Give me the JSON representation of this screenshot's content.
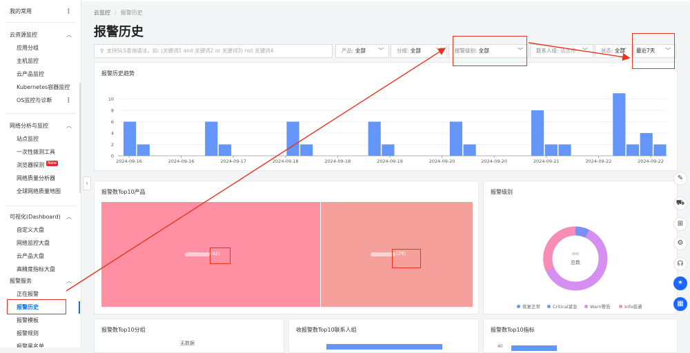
{
  "sidebar": {
    "favorites": "我的常用",
    "groups": [
      {
        "label": "云资源监控",
        "items": [
          "应用分组",
          "主机监控",
          "云产品监控",
          "Kubernetes容器监控",
          "OS监控与诊断"
        ]
      },
      {
        "label": "网络分析与监控",
        "items": [
          "站点监控",
          "一次性拨测工具",
          "浏览器探测",
          "网络质量分析器",
          "全球网络质量地图"
        ]
      },
      {
        "label": "可视化(Dashboard)",
        "items": [
          "自定义大盘",
          "网络监控大盘",
          "云产品大盘",
          "高精度指标大盘"
        ]
      },
      {
        "label": "报警服务",
        "items": [
          "正在报警",
          "报警历史",
          "报警模板",
          "报警规则",
          "报警黑名单"
        ]
      }
    ],
    "new_badge": "New"
  },
  "breadcrumb": {
    "root": "云监控",
    "current": "报警历史"
  },
  "page_title": "报警历史",
  "filters": {
    "search_placeholder": "支持SLS查询语法，如: (关键词1 and 关键词2 or 关键词3) not 关键词4",
    "product_label": "产品:",
    "product_value": "全部",
    "group_label": "分组:",
    "group_value": "全部",
    "level_label": "报警级别:",
    "level_value": "全部",
    "contact_label": "联系人组:",
    "contact_value": "请选择",
    "status_label": "状态:",
    "status_value": "全部",
    "time_value": "最近7天"
  },
  "trend_card": {
    "title": "报警历史趋势"
  },
  "chart_data": {
    "type": "bar",
    "ylim": [
      0,
      12
    ],
    "yticks": [
      0,
      2,
      4,
      6,
      8,
      10
    ],
    "xticks": [
      "2024-09-16",
      "2024-09-16",
      "2024-09-17",
      "2024-09-18",
      "2024-09-18",
      "2024-09-19",
      "2024-09-20",
      "2024-09-20",
      "2024-09-21",
      "2024-09-22",
      "2024-09-22"
    ],
    "values": [
      6,
      2,
      6,
      2,
      6,
      2,
      6,
      2,
      6,
      2,
      8,
      2,
      2,
      11,
      2,
      4,
      2
    ],
    "color": "#6495f8"
  },
  "top10_products": {
    "title": "报警数Top10产品",
    "cells": [
      {
        "label": "(42)",
        "value": 42,
        "color": "#ff8fa3"
      },
      {
        "label": "(29)",
        "value": 29,
        "color": "#f5a09a"
      }
    ]
  },
  "level_card": {
    "title": "报警级别",
    "center_label": "总数",
    "legend": [
      {
        "label": "恢复正常",
        "color": "#6495f8"
      },
      {
        "label": "Critical紧急",
        "color": "#7b8ff0"
      },
      {
        "label": "Warn警告",
        "color": "#d58ff0"
      },
      {
        "label": "Info普通",
        "color": "#f78cb4"
      }
    ]
  },
  "top10_groups": {
    "title": "报警数Top10分组",
    "empty": "无数据"
  },
  "top10_contacts": {
    "title": "收报警数Top10联系人组"
  },
  "top10_metrics": {
    "title": "报警数Top10指标",
    "first_tick": "40"
  },
  "float_bar": {
    "icons": [
      "edit-icon",
      "cart-icon",
      "shop-icon",
      "gear-icon",
      "headset-icon",
      "assistant-icon",
      "apps-icon"
    ]
  },
  "colors": {
    "accent": "#0a6ff0",
    "annotation": "#e8331c",
    "bar": "#6495f8"
  }
}
